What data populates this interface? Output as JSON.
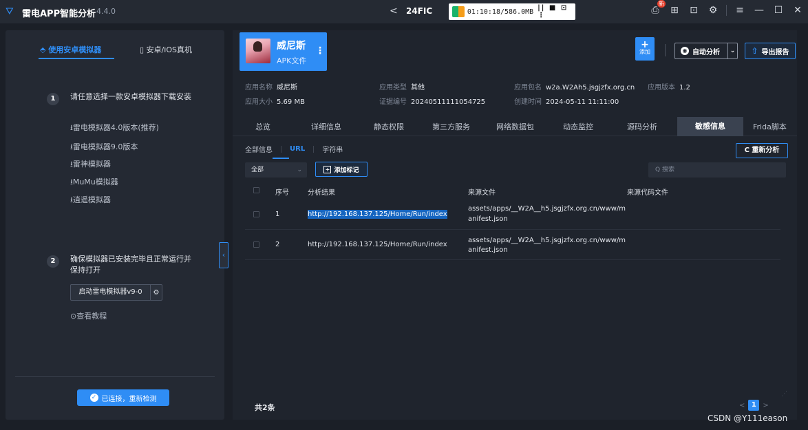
{
  "titlebar": {
    "app_name": "雷电APP智能分析",
    "version": "4.4.0",
    "back_glyph": "<",
    "center_title": "24FIC",
    "recorder": {
      "time": "01:10:18/586.0MB",
      "controls": "|| ■ ⊡ ⋮"
    },
    "icons": [
      "new-feature-icon",
      "briefcase-icon",
      "chart-icon",
      "gear-icon",
      "menu-icon",
      "minimize-icon",
      "maximize-icon",
      "close-icon"
    ],
    "new_badge": "新"
  },
  "left": {
    "tabs": {
      "android": "使用安卓模拟器",
      "ios": "安卓/iOS真机"
    },
    "step1": {
      "num": "1",
      "text": "请任意选择一款安卓模拟器下载安装"
    },
    "downloads": [
      "⭳雷电模拟器4.0版本(推荐)",
      "⭳雷电模拟器9.0版本",
      "⭳雷神模拟器",
      "⭳MuMu模拟器",
      "⭳逍遥模拟器"
    ],
    "step2": {
      "num": "2",
      "text": "确保模拟器已安装完毕且正常运行并保持打开"
    },
    "launch_label": "启动雷电模拟器v9-0",
    "tutorial": "⊙查看教程",
    "connect_label": "已连接，重新检测"
  },
  "app": {
    "name": "威尼斯",
    "type": "APK文件",
    "more": "⋮",
    "add_label": "添加",
    "auto_label": "自动分析",
    "export_label": "导出报告",
    "info": {
      "name_label": "应用名称",
      "name": "威尼斯",
      "type_label": "应用类型",
      "type": "其他",
      "pkg_label": "应用包名",
      "pkg": "w2a.W2Ah5.jsgjzfx.org.cn",
      "ver_label": "应用版本",
      "ver": "1.2",
      "size_label": "应用大小",
      "size": "5.69 MB",
      "cert_label": "证据编号",
      "cert": "20240511111054725",
      "created_label": "创建时间",
      "created": "2024-05-11 11:11:00"
    }
  },
  "tabs": [
    "总览",
    "详细信息",
    "静态权限",
    "第三方服务",
    "网络数据包",
    "动态监控",
    "源码分析",
    "敏感信息",
    "Frida脚本"
  ],
  "subtabs": [
    "全部信息",
    "URL",
    "字符串"
  ],
  "reanalyze_label": "C 重新分析",
  "filter": {
    "value": "全部",
    "chevron": "⌄"
  },
  "add_tag_label": "添加标记",
  "search_placeholder": "Q 搜索",
  "table": {
    "headers": {
      "index": "序号",
      "result": "分析结果",
      "source": "来源文件",
      "source_code": "来源代码文件"
    },
    "rows": [
      {
        "index": "1",
        "result": "http://192.168.137.125/Home/Run/index",
        "source_l1": "assets/apps/__W2A__h5.jsgjzfx.org.cn/www/m",
        "source_l2": "anifest.json",
        "selected": true
      },
      {
        "index": "2",
        "result": "http://192.168.137.125/Home/Run/index",
        "source_l1": "assets/apps/__W2A__h5.jsgjzfx.org.cn/www/m",
        "source_l2": "anifest.json",
        "selected": false
      }
    ]
  },
  "total": "共2条",
  "pager": {
    "prev": "<",
    "page": "1",
    "next": ">"
  },
  "watermark": "CSDN @Y111eason",
  "colors": {
    "accent": "#2f8df5",
    "bg": "#1b1f27",
    "panel": "#242933"
  }
}
